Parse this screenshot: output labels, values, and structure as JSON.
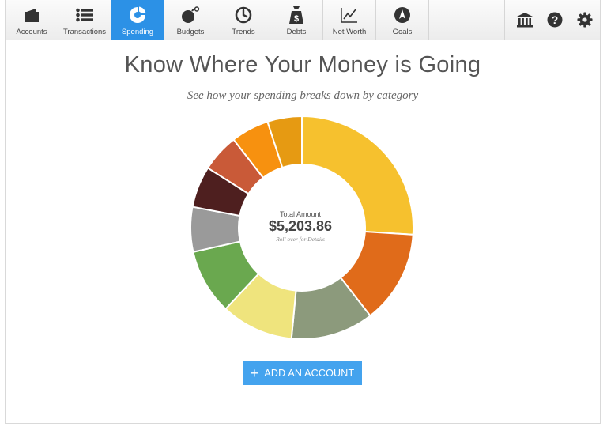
{
  "nav": {
    "tabs": [
      {
        "label": "Accounts",
        "icon": "wallet-icon"
      },
      {
        "label": "Transactions",
        "icon": "list-icon"
      },
      {
        "label": "Spending",
        "icon": "pie-chart-icon"
      },
      {
        "label": "Budgets",
        "icon": "bomb-icon"
      },
      {
        "label": "Trends",
        "icon": "clock-icon"
      },
      {
        "label": "Debts",
        "icon": "money-bag-icon"
      },
      {
        "label": "Net Worth",
        "icon": "line-graph-icon"
      },
      {
        "label": "Goals",
        "icon": "compass-icon"
      }
    ],
    "active_tab": "Spending",
    "utilities": [
      "bank-icon",
      "help-icon",
      "settings-icon"
    ]
  },
  "page": {
    "title": "Know Where Your Money is Going",
    "subtitle": "See how your spending breaks down by category"
  },
  "donut": {
    "total_label": "Total Amount",
    "total_amount": "$5,203.86",
    "hint": "Roll over for Details"
  },
  "action": {
    "add_account_label": "ADD AN ACCOUNT"
  },
  "chart_data": {
    "type": "pie",
    "slices": [
      {
        "value": 26.0,
        "color": "#f6c12e"
      },
      {
        "value": 13.5,
        "color": "#e06b1a"
      },
      {
        "value": 12.0,
        "color": "#8c9a7c"
      },
      {
        "value": 10.5,
        "color": "#efe47d"
      },
      {
        "value": 9.5,
        "color": "#6aa84f"
      },
      {
        "value": 6.5,
        "color": "#9a9a9a"
      },
      {
        "value": 6.0,
        "color": "#4e1f1f"
      },
      {
        "value": 5.5,
        "color": "#c95a38"
      },
      {
        "value": 5.5,
        "color": "#f7910f"
      },
      {
        "value": 5.0,
        "color": "#e69a12"
      }
    ]
  },
  "colors": {
    "accent": "#2c91e6",
    "button": "#44a3ee"
  }
}
